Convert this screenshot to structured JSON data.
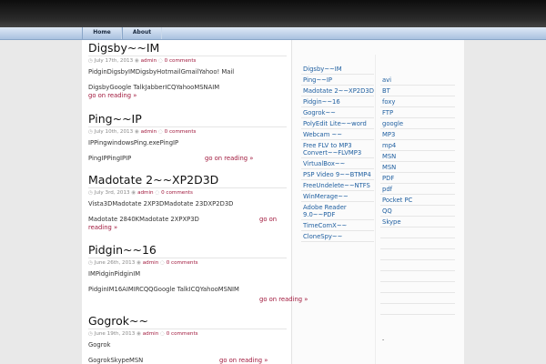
{
  "nav": {
    "items": [
      "Home",
      "About"
    ]
  },
  "posts": [
    {
      "title": "Digsby~~IM",
      "date": "July 17th, 2013",
      "author": "admin",
      "comments": "0 comments",
      "body1": "PidginDigsbyIMDigsbyHotmailGmailYahoo! Mail",
      "body2": "DigsbyGoogle TalkJabberICQYahooMSNAIM",
      "more": "go on reading »"
    },
    {
      "title": "Ping~~IP",
      "date": "July 10th, 2013",
      "author": "admin",
      "comments": "0 comments",
      "body1": "IPPingwindowsPing.exePingIP",
      "body2": "PingIPPingIPIP",
      "more": "go on reading »"
    },
    {
      "title": "Madotate 2~~XP2D3D",
      "date": "July 3rd, 2013",
      "author": "admin",
      "comments": "0 comments",
      "body1": "Vista3DMadotate 2XP3DMadotate 23DXP2D3D",
      "body2": "Madotate 2840KMadotate 2XPXP3D",
      "more_a": "go on",
      "more_b": "reading »"
    },
    {
      "title": "Pidgin~~16",
      "date": "June 26th, 2013",
      "author": "admin",
      "comments": "0 comments",
      "body1": "IMPidginPidginIM",
      "body2": "PidginIM16AIMIRCQQGoogle TalkICQYahooMSNIM",
      "more": "go on reading »"
    },
    {
      "title": "Gogrok~~",
      "date": "June 19th, 2013",
      "author": "admin",
      "comments": "0 comments",
      "body1": "Gogrok",
      "body2": "GogrokSkypeMSN",
      "more": "go on reading »"
    }
  ],
  "sidebar_posts": [
    "Digsby~~IM",
    "Ping~~IP",
    "Madotate 2~~XP2D3D",
    "Pidgin~~16",
    "Gogrok~~",
    "PolyEdit Lite~~word",
    "Webcam ~~",
    "Free FLV to MP3 Convert~~FLVMP3",
    "VirtualBox~~",
    "PSP Video 9~~BTMP4",
    "FreeUndelete~~NTFS",
    "WinMerage~~",
    "Adobe Reader 9.0~~PDF",
    "TimeComX~~",
    "CloneSpy~~"
  ],
  "tags": [
    "avi",
    "BT",
    "foxy",
    "FTP",
    "google",
    "MP3",
    "mp4",
    "MSN",
    "MSN",
    "PDF",
    "pdf",
    "Pocket PC",
    "QQ",
    "Skype",
    "",
    "",
    "",
    "",
    "",
    "",
    "",
    ""
  ],
  "dash": "-"
}
